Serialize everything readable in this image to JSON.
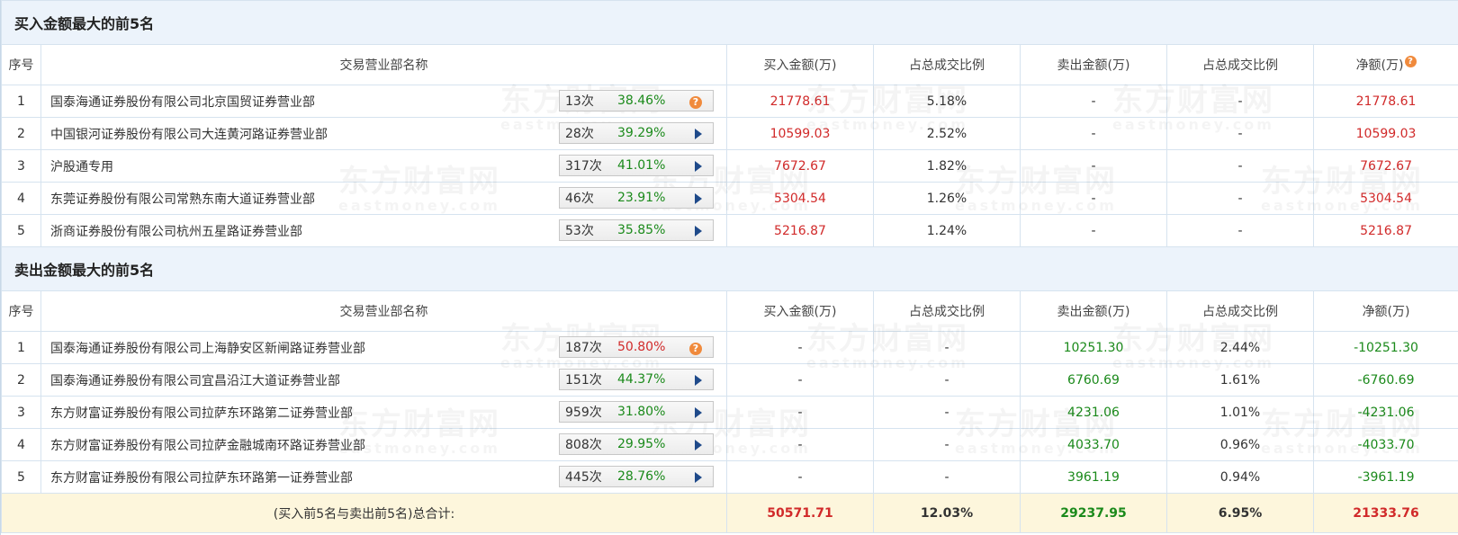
{
  "watermark": {
    "cn": "东方财富网",
    "en": "eastmoney.com"
  },
  "columns": [
    "序号",
    "交易营业部名称",
    "买入金额(万)",
    "占总成交比例",
    "卖出金额(万)",
    "占总成交比例",
    "净额(万)"
  ],
  "buy_section": {
    "title": "买入金额最大的前5名",
    "rows": [
      {
        "no": "1",
        "name": "国泰海通证券股份有限公司北京国贸证券营业部",
        "count": "13次",
        "pct": "38.46%",
        "pct_color": "green",
        "icon": "question-icon",
        "buy": "21778.61",
        "buy_ratio": "5.18%",
        "sell": "-",
        "sell_ratio": "-",
        "net": "21778.61",
        "net_color": "red"
      },
      {
        "no": "2",
        "name": "中国银河证券股份有限公司大连黄河路证券营业部",
        "count": "28次",
        "pct": "39.29%",
        "pct_color": "green",
        "icon": "play-icon",
        "buy": "10599.03",
        "buy_ratio": "2.52%",
        "sell": "-",
        "sell_ratio": "-",
        "net": "10599.03",
        "net_color": "red"
      },
      {
        "no": "3",
        "name": "沪股通专用",
        "count": "317次",
        "pct": "41.01%",
        "pct_color": "green",
        "icon": "play-icon",
        "buy": "7672.67",
        "buy_ratio": "1.82%",
        "sell": "-",
        "sell_ratio": "-",
        "net": "7672.67",
        "net_color": "red"
      },
      {
        "no": "4",
        "name": "东莞证券股份有限公司常熟东南大道证券营业部",
        "count": "46次",
        "pct": "23.91%",
        "pct_color": "green",
        "icon": "play-icon",
        "buy": "5304.54",
        "buy_ratio": "1.26%",
        "sell": "-",
        "sell_ratio": "-",
        "net": "5304.54",
        "net_color": "red"
      },
      {
        "no": "5",
        "name": "浙商证券股份有限公司杭州五星路证券营业部",
        "count": "53次",
        "pct": "35.85%",
        "pct_color": "green",
        "icon": "play-icon",
        "buy": "5216.87",
        "buy_ratio": "1.24%",
        "sell": "-",
        "sell_ratio": "-",
        "net": "5216.87",
        "net_color": "red"
      }
    ]
  },
  "sell_section": {
    "title": "卖出金额最大的前5名",
    "rows": [
      {
        "no": "1",
        "name": "国泰海通证券股份有限公司上海静安区新闸路证券营业部",
        "count": "187次",
        "pct": "50.80%",
        "pct_color": "red",
        "icon": "question-icon",
        "buy": "-",
        "buy_ratio": "-",
        "sell": "10251.30",
        "sell_ratio": "2.44%",
        "net": "-10251.30",
        "net_color": "green"
      },
      {
        "no": "2",
        "name": "国泰海通证券股份有限公司宜昌沿江大道证券营业部",
        "count": "151次",
        "pct": "44.37%",
        "pct_color": "green",
        "icon": "play-icon",
        "buy": "-",
        "buy_ratio": "-",
        "sell": "6760.69",
        "sell_ratio": "1.61%",
        "net": "-6760.69",
        "net_color": "green"
      },
      {
        "no": "3",
        "name": "东方财富证券股份有限公司拉萨东环路第二证券营业部",
        "count": "959次",
        "pct": "31.80%",
        "pct_color": "green",
        "icon": "play-icon",
        "buy": "-",
        "buy_ratio": "-",
        "sell": "4231.06",
        "sell_ratio": "1.01%",
        "net": "-4231.06",
        "net_color": "green"
      },
      {
        "no": "4",
        "name": "东方财富证券股份有限公司拉萨金融城南环路证券营业部",
        "count": "808次",
        "pct": "29.95%",
        "pct_color": "green",
        "icon": "play-icon",
        "buy": "-",
        "buy_ratio": "-",
        "sell": "4033.70",
        "sell_ratio": "0.96%",
        "net": "-4033.70",
        "net_color": "green"
      },
      {
        "no": "5",
        "name": "东方财富证券股份有限公司拉萨东环路第一证券营业部",
        "count": "445次",
        "pct": "28.76%",
        "pct_color": "green",
        "icon": "play-icon",
        "buy": "-",
        "buy_ratio": "-",
        "sell": "3961.19",
        "sell_ratio": "0.94%",
        "net": "-3961.19",
        "net_color": "green"
      }
    ]
  },
  "total": {
    "label": "(买入前5名与卖出前5名)总合计:",
    "buy": "50571.71",
    "buy_ratio": "12.03%",
    "sell": "29237.95",
    "sell_ratio": "6.95%",
    "net": "21333.76"
  },
  "colors": {
    "red": "#d12a2a",
    "green": "#1b8a1b",
    "header_bg": "#ecf3fb",
    "total_bg": "#fdf6dc"
  }
}
